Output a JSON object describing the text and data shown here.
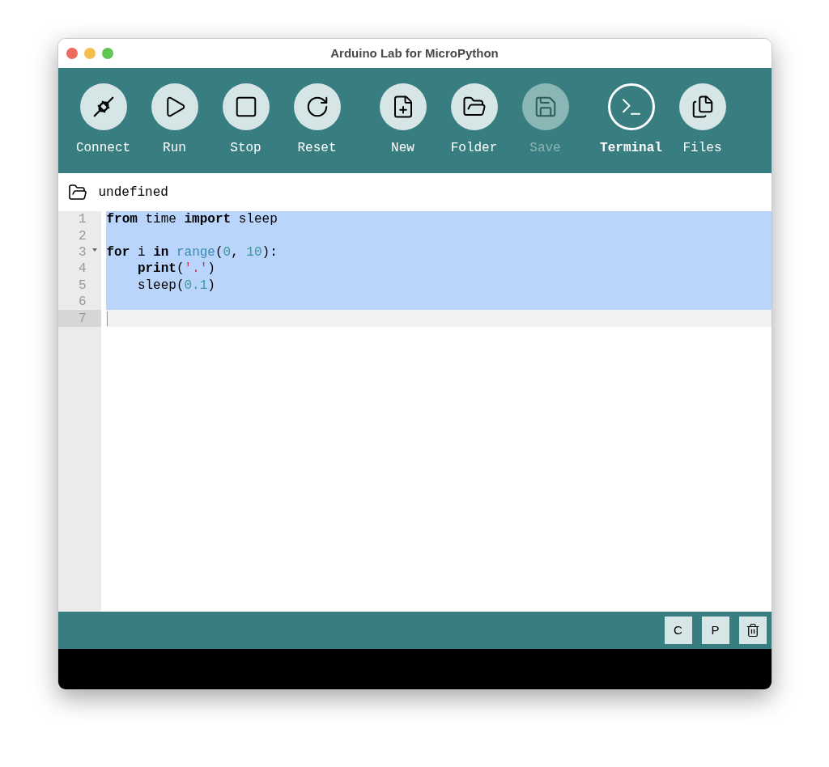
{
  "window": {
    "title": "Arduino Lab for MicroPython"
  },
  "toolbar": {
    "groups": [
      [
        {
          "kind": "connect",
          "label": "Connect",
          "disabled": false,
          "active": false
        },
        {
          "kind": "run",
          "label": "Run",
          "disabled": false,
          "active": false
        },
        {
          "kind": "stop",
          "label": "Stop",
          "disabled": false,
          "active": false
        },
        {
          "kind": "reset",
          "label": "Reset",
          "disabled": false,
          "active": false
        }
      ],
      [
        {
          "kind": "new",
          "label": "New",
          "disabled": false,
          "active": false
        },
        {
          "kind": "folder",
          "label": "Folder",
          "disabled": false,
          "active": false
        },
        {
          "kind": "save",
          "label": "Save",
          "disabled": true,
          "active": false
        }
      ],
      [
        {
          "kind": "terminal",
          "label": "Terminal",
          "disabled": false,
          "active": true
        },
        {
          "kind": "files",
          "label": "Files",
          "disabled": false,
          "active": false
        }
      ]
    ]
  },
  "path": {
    "text": "undefined"
  },
  "editor": {
    "lines": [
      {
        "number": "1",
        "selected": true,
        "current": false,
        "foldable": false,
        "tokens": [
          {
            "kind": "keyword",
            "text": "from"
          },
          {
            "kind": "plain",
            "text": " time "
          },
          {
            "kind": "keyword",
            "text": "import"
          },
          {
            "kind": "plain",
            "text": " sleep"
          }
        ]
      },
      {
        "number": "2",
        "selected": true,
        "current": false,
        "foldable": false
      },
      {
        "number": "3",
        "selected": true,
        "current": false,
        "foldable": true,
        "tokens": [
          {
            "kind": "keyword",
            "text": "for"
          },
          {
            "kind": "plain",
            "text": " i "
          },
          {
            "kind": "keyword",
            "text": "in"
          },
          {
            "kind": "builtin",
            "text": " range"
          },
          {
            "kind": "plain",
            "text": "("
          },
          {
            "kind": "number",
            "text": "0"
          },
          {
            "kind": "plain",
            "text": ", "
          },
          {
            "kind": "number",
            "text": "10"
          },
          {
            "kind": "plain",
            "text": "):"
          }
        ]
      },
      {
        "number": "4",
        "selected": true,
        "current": false,
        "foldable": false,
        "tokens": [
          {
            "kind": "keyword",
            "text": "    print"
          },
          {
            "kind": "plain",
            "text": "("
          },
          {
            "kind": "string",
            "text": "'.'"
          },
          {
            "kind": "plain",
            "text": ")"
          }
        ]
      },
      {
        "number": "5",
        "selected": true,
        "current": false,
        "foldable": false,
        "tokens": [
          {
            "kind": "plain",
            "text": "    sleep("
          },
          {
            "kind": "number",
            "text": "0.1"
          },
          {
            "kind": "plain",
            "text": ")"
          }
        ]
      },
      {
        "number": "6",
        "selected": true,
        "current": false,
        "foldable": false
      },
      {
        "number": "7",
        "selected": false,
        "current": true,
        "foldable": false
      }
    ]
  },
  "panel": {
    "buttons": [
      {
        "kind": "text",
        "label": "C"
      },
      {
        "kind": "text",
        "label": "P"
      },
      {
        "kind": "trash"
      }
    ]
  }
}
